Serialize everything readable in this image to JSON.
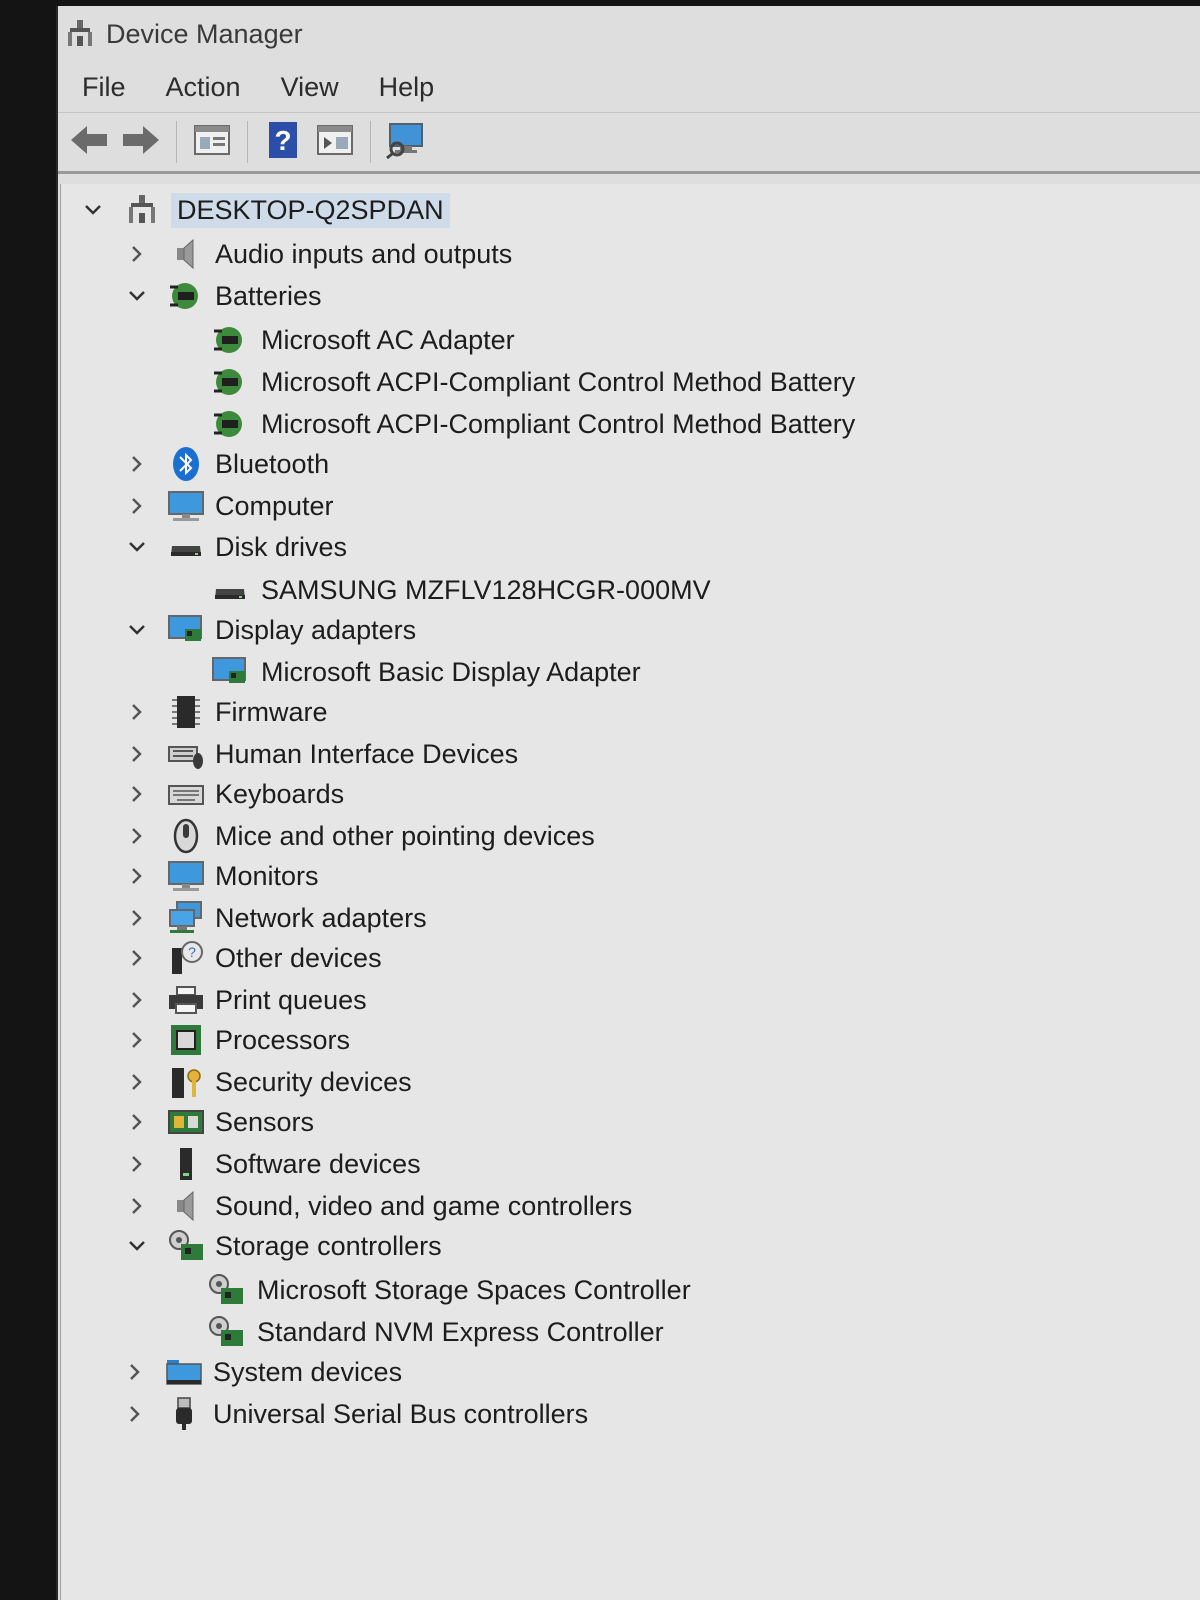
{
  "window": {
    "title": "Device Manager"
  },
  "menu": {
    "file": "File",
    "action": "Action",
    "view": "View",
    "help": "Help"
  },
  "toolbar": {
    "buttons": [
      "back-icon",
      "forward-icon",
      "properties-icon",
      "help-icon",
      "update-driver-icon",
      "scan-hardware-icon"
    ]
  },
  "tree": {
    "root": "DESKTOP-Q2SPDAN",
    "categories": {
      "audio": "Audio inputs and outputs",
      "batteries": "Batteries",
      "bluetooth": "Bluetooth",
      "computer": "Computer",
      "disk_drives": "Disk drives",
      "display_adapters": "Display adapters",
      "firmware": "Firmware",
      "hid": "Human Interface Devices",
      "keyboards": "Keyboards",
      "mice": "Mice and other pointing devices",
      "monitors": "Monitors",
      "network": "Network adapters",
      "other": "Other devices",
      "print": "Print queues",
      "processors": "Processors",
      "security": "Security devices",
      "sensors": "Sensors",
      "software": "Software devices",
      "sound": "Sound, video and game controllers",
      "storage": "Storage controllers",
      "system": "System devices",
      "usb": "Universal Serial Bus controllers"
    },
    "devices": {
      "ac_adapter": "Microsoft AC Adapter",
      "battery_1": "Microsoft ACPI-Compliant Control Method Battery",
      "battery_2": "Microsoft ACPI-Compliant Control Method Battery",
      "samsung": "SAMSUNG MZFLV128HCGR-000MV",
      "basic_display": "Microsoft Basic Display Adapter",
      "storage_spaces": "Microsoft Storage Spaces Controller",
      "nvm": "Standard NVM Express Controller"
    }
  }
}
